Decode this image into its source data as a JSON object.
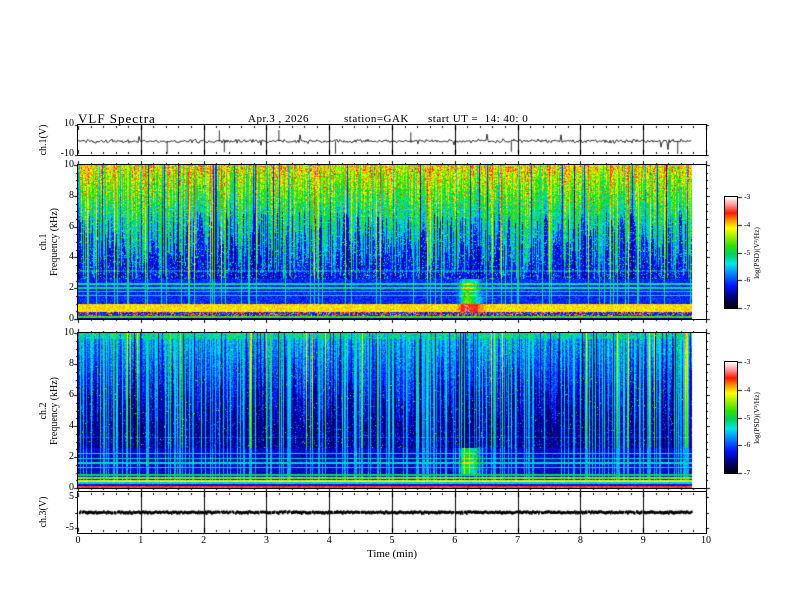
{
  "header": {
    "title": "VLF Spectra",
    "date": "Apr.3 , 2026",
    "station": "station=GAK",
    "start_ut": "start UT =  14: 40: 0"
  },
  "axes": {
    "time_label": "Time  (min)",
    "time_ticks": [
      "0",
      "1",
      "2",
      "3",
      "4",
      "5",
      "6",
      "7",
      "8",
      "9",
      "10"
    ],
    "ch1_wave": {
      "ylabel": "ch.1(V)",
      "yticks": [
        "10",
        "-10"
      ]
    },
    "ch1_spec": {
      "ylabel_channel": "ch.1",
      "ylabel_freq": "Frequency (kHz)",
      "yticks": [
        "10",
        "8",
        "6",
        "4",
        "2",
        "0"
      ]
    },
    "ch2_spec": {
      "ylabel_channel": "ch.2",
      "ylabel_freq": "Frequency (kHz)",
      "yticks": [
        "10",
        "8",
        "6",
        "4",
        "2",
        "0"
      ]
    },
    "ch3_wave": {
      "ylabel": "ch.3(V)",
      "yticks": [
        "5",
        "-5"
      ]
    }
  },
  "colorbar": {
    "label": "log(PSD)(V²/Hz)",
    "ticks": [
      "-3",
      "-4",
      "-5",
      "-6",
      "-7"
    ]
  },
  "chart_data": {
    "type": "heatmap",
    "figure": "VLF receiver quick-look plot: waveform, two spectrograms, flat channel",
    "title": "VLF Spectra",
    "date": "Apr.3 , 2026",
    "station": "GAK",
    "start_ut": "14:40:0",
    "time_axis": {
      "label": "Time (min)",
      "range": [
        0,
        10
      ],
      "ticks": [
        0,
        1,
        2,
        3,
        4,
        5,
        6,
        7,
        8,
        9,
        10
      ],
      "data_end_min": 9.8,
      "grid_minutes": true
    },
    "colorbar": {
      "label": "log(PSD)(V^2/Hz)",
      "ticks": [
        -3,
        -4,
        -5,
        -6,
        -7
      ],
      "range": [
        -7,
        -3
      ],
      "colormap_stops": [
        [
          0.0,
          "#000006"
        ],
        [
          0.1,
          "#00007e"
        ],
        [
          0.2,
          "#0014ff"
        ],
        [
          0.32,
          "#0090ff"
        ],
        [
          0.4,
          "#00e8e8"
        ],
        [
          0.48,
          "#00d060"
        ],
        [
          0.56,
          "#30e000"
        ],
        [
          0.65,
          "#a8f000"
        ],
        [
          0.72,
          "#ffff00"
        ],
        [
          0.79,
          "#ff9000"
        ],
        [
          0.855,
          "#ff1800"
        ],
        [
          0.93,
          "#ff9898"
        ],
        [
          1.0,
          "#ffffff"
        ]
      ]
    },
    "panels": [
      {
        "name": "ch1_waveform",
        "type": "line",
        "ylabel": "ch.1(V)",
        "yrange": [
          -10,
          10
        ],
        "yticks": [
          10,
          -10
        ],
        "description": "black broadband noise trace near 0 V with impulsive sferic spikes",
        "mean_level_v": -1,
        "spike_times_min_down": [
          1.42,
          2.33,
          4.1,
          6.9,
          9.55
        ],
        "spike_times_min_up": [
          2.25,
          3.2,
          5.3,
          8.0
        ]
      },
      {
        "name": "ch1_spectrogram",
        "type": "heatmap",
        "ylabel": "ch.1 Frequency (kHz)",
        "yrange_khz": [
          0,
          10
        ],
        "yticks": [
          0,
          2,
          4,
          6,
          8,
          10
        ],
        "log_psd_range": [
          -7,
          -3
        ],
        "features": {
          "broadband_top_khz": [
            7,
            10
          ],
          "sferic_streaks": "dense green/yellow vertical impulsive streaks fading into dark blue below ~5 kHz",
          "hiss_band_khz": [
            0.5,
            1.0
          ],
          "hiss_level": "yellow-orange, log PSD near -3.6",
          "low_mottled_band_khz": [
            0.22,
            0.5
          ],
          "narrow_green_line_khz": 0.15,
          "line_interference_khz": [
            1.55,
            1.8,
            2.05,
            2.3
          ],
          "event_time_min": [
            6.0,
            6.35
          ],
          "event_freq_khz": [
            1.0,
            2.8
          ],
          "event_note": "green plume rising from intensified red hiss band near 6.1 min"
        }
      },
      {
        "name": "ch2_spectrogram",
        "type": "heatmap",
        "ylabel": "ch.2 Frequency (kHz)",
        "yrange_khz": [
          0,
          10
        ],
        "yticks": [
          0,
          2,
          4,
          6,
          8,
          10
        ],
        "log_psd_range": [
          -7,
          -3
        ],
        "features": {
          "sferic_streaks": "sparser cyan vertical streaks on near-black background",
          "line_interference_khz": [
            1.35,
            1.65,
            1.95,
            2.25
          ],
          "bottom_stripes_khz": [
            [
              0.8,
              0.95
            ],
            [
              0.6,
              0.74
            ],
            [
              0.42,
              0.56
            ],
            [
              0.3,
              0.42
            ],
            [
              0.17,
              0.3
            ],
            [
              0.05,
              0.14
            ]
          ],
          "bottom_stripe_levels": [
            0.45,
            0.58,
            0.66,
            0.34,
            0.14,
            0.82
          ],
          "event_time_min": [
            6.0,
            6.35
          ],
          "event_freq_khz": [
            0.95,
            2.6
          ],
          "event_note": "green/cyan blob near 6.1 min between 1 and 2.5 kHz"
        }
      },
      {
        "name": "ch3_waveform",
        "type": "line",
        "ylabel": "ch.3(V)",
        "yrange": [
          -5,
          5
        ],
        "yticks": [
          5,
          -5
        ],
        "description": "thick flat black trace at 0 V, ends at 9.8 min"
      }
    ]
  }
}
